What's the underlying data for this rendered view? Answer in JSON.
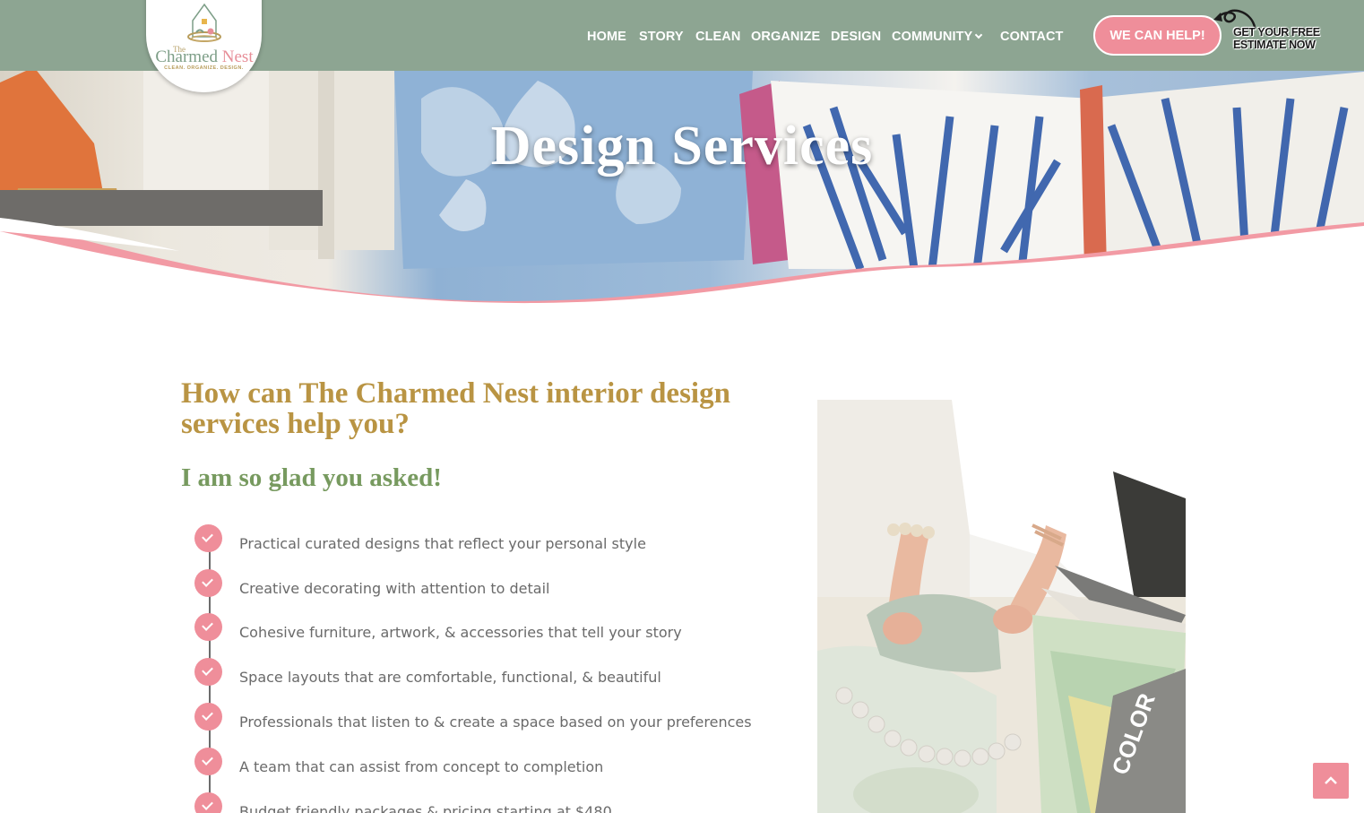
{
  "header": {
    "logo": {
      "the": "The",
      "name_part1": "Charmed",
      "name_part2": "Nest",
      "tagline": "CLEAN. ORGANIZE. DESIGN."
    },
    "nav": [
      {
        "label": "HOME"
      },
      {
        "label": "STORY"
      },
      {
        "label": "CLEAN"
      },
      {
        "label": "ORGANIZE"
      },
      {
        "label": "DESIGN"
      },
      {
        "label": "COMMUNITY",
        "has_dropdown": true
      },
      {
        "label": "CONTACT"
      }
    ],
    "cta_label": "WE CAN HELP!",
    "estimate_text": "GET YOUR FREE\nESTIMATE NOW"
  },
  "hero": {
    "title": "Design Services"
  },
  "main": {
    "heading": "How can The Charmed Nest interior design services help you?",
    "subheading": "I am so glad you asked!",
    "checklist": [
      "Practical curated designs that reflect your personal style",
      "Creative decorating with attention to detail",
      "Cohesive furniture, artwork, & accessories that tell your story",
      "Space layouts that are comfortable, functional, & beautiful",
      "Professionals that listen to & create a space based on your preferences",
      "A team that can assist from concept to completion",
      "Budget friendly packages & pricing starting at $480"
    ]
  },
  "colors": {
    "header_bg": "#8da592",
    "accent_pink": "#ef8e9a",
    "heading_gold": "#b99443",
    "subheading_green": "#779a5f"
  },
  "icons": {
    "back_to_top": "chevron-up-icon",
    "check": "check-icon",
    "dropdown": "chevron-down-icon"
  }
}
